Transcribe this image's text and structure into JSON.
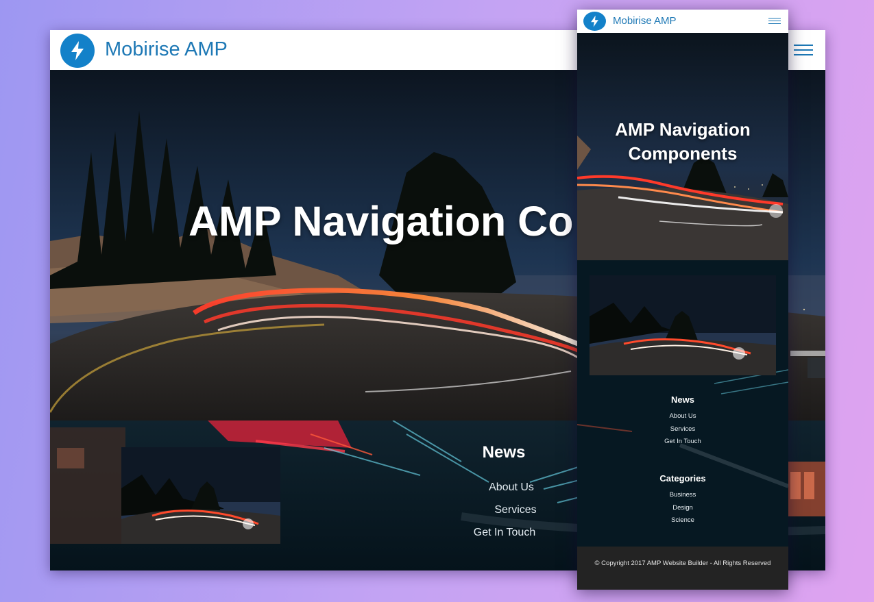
{
  "brand": {
    "name": "Mobirise AMP"
  },
  "hero": {
    "title": "AMP Navigation Components"
  },
  "desktop": {
    "hero_title_visible": "AMP Navigation Co",
    "news": {
      "heading": "News",
      "links": [
        "About Us",
        "Services",
        "Get In Touch"
      ]
    }
  },
  "mobile": {
    "hero_title_line1": "AMP Navigation",
    "hero_title_line2": "Components",
    "news": {
      "heading": "News",
      "links": [
        "About Us",
        "Services",
        "Get In Touch"
      ]
    },
    "categories": {
      "heading": "Categories",
      "links": [
        "Business",
        "Design",
        "Science"
      ]
    },
    "copyright": "© Copyright 2017 AMP Website Builder - All Rights Reserved"
  },
  "icons": {
    "logo": "lightning-bolt-icon",
    "menu": "hamburger-menu-icon"
  },
  "colors": {
    "accent": "#1381c9",
    "brand_text": "#1d78b5",
    "footer_bg": "#232323"
  }
}
